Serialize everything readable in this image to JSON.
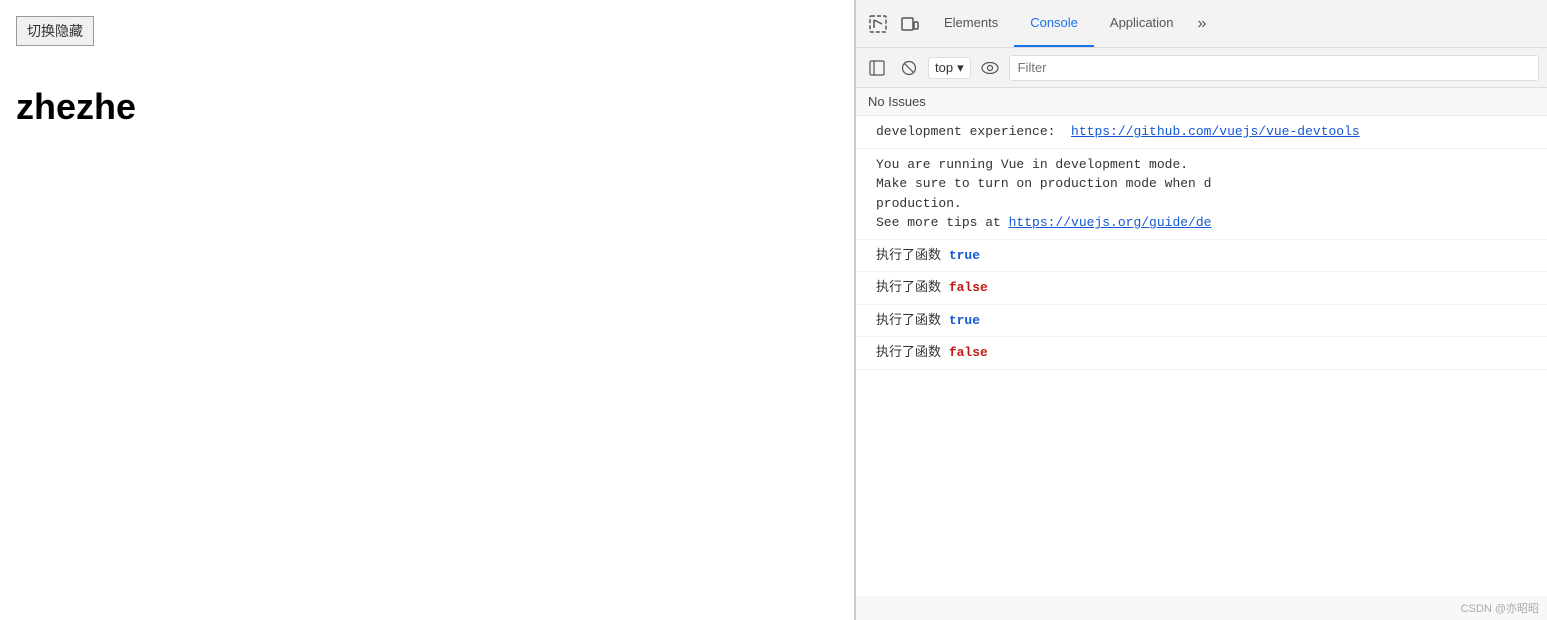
{
  "left": {
    "toggle_button": "切换隐藏",
    "heading": "zhezhe"
  },
  "devtools": {
    "tabs": [
      {
        "label": "Elements",
        "active": false
      },
      {
        "label": "Console",
        "active": true
      },
      {
        "label": "Application",
        "active": false
      }
    ],
    "tab_more": "»",
    "console": {
      "top_label": "top",
      "filter_placeholder": "Filter",
      "no_issues": "No Issues",
      "entries": [
        {
          "type": "text_with_link",
          "text": "development experience: ",
          "link_text": "https://github.com/vuejs/vue-devtools",
          "link_href": "https://github.com/vuejs/vue-devtools"
        },
        {
          "type": "multiline",
          "lines": [
            "You are running Vue in development mode.",
            "Make sure to turn on production mode when d",
            "production.",
            "See more tips at "
          ],
          "link_text": "https://vuejs.org/guide/de",
          "link_href": "https://vuejs.org/guide/deployment.html"
        },
        {
          "type": "log_bool",
          "text": "执行了函数",
          "bool": "true",
          "bool_color": "true"
        },
        {
          "type": "log_bool",
          "text": "执行了函数",
          "bool": "false",
          "bool_color": "false"
        },
        {
          "type": "log_bool",
          "text": "执行了函数",
          "bool": "true",
          "bool_color": "true"
        },
        {
          "type": "log_bool",
          "text": "执行了函数",
          "bool": "false",
          "bool_color": "false"
        }
      ]
    },
    "watermark": "CSDN @亦昭昭"
  }
}
